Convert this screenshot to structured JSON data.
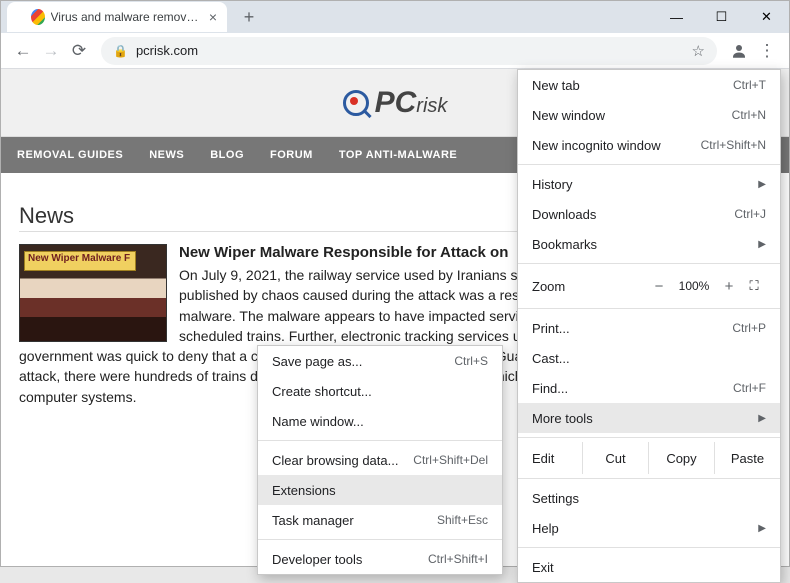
{
  "tab": {
    "title": "Virus and malware removal instru"
  },
  "url": "pcrisk.com",
  "logo": {
    "main": "PC",
    "sub": "risk"
  },
  "nav": [
    "REMOVAL GUIDES",
    "NEWS",
    "BLOG",
    "FORUM",
    "TOP ANTI-MALWARE"
  ],
  "section_title": "News",
  "article": {
    "thumb_label": "New Wiper Malware F",
    "headline": "New Wiper Malware Responsible for Attack on",
    "body": "On July 9, 2021, the railway service used by Iranians suffered a cyber attack. New research published by chaos caused during the attack was a result of a previously unknown wiper malware. The malware appears to have impacted services, as reports emerged of delays of scheduled trains. Further, electronic tracking services used by the train service also failed. The government was quick to deny that a cyber attack had occurred, saying. The Guardian reported that even a day after the attack, there were hundreds of trains delayed or cancelled the initial attack, which caused widespread disruption in … computer systems."
  },
  "menu": {
    "new_tab": "New tab",
    "new_tab_sc": "Ctrl+T",
    "new_window": "New window",
    "new_window_sc": "Ctrl+N",
    "incognito": "New incognito window",
    "incognito_sc": "Ctrl+Shift+N",
    "history": "History",
    "downloads": "Downloads",
    "downloads_sc": "Ctrl+J",
    "bookmarks": "Bookmarks",
    "zoom": "Zoom",
    "zoom_val": "100%",
    "print": "Print...",
    "print_sc": "Ctrl+P",
    "cast": "Cast...",
    "find": "Find...",
    "find_sc": "Ctrl+F",
    "more_tools": "More tools",
    "edit": "Edit",
    "cut": "Cut",
    "copy": "Copy",
    "paste": "Paste",
    "settings": "Settings",
    "help": "Help",
    "exit": "Exit"
  },
  "submenu": {
    "save_page": "Save page as...",
    "save_page_sc": "Ctrl+S",
    "shortcut": "Create shortcut...",
    "name_window": "Name window...",
    "clear_data": "Clear browsing data...",
    "clear_data_sc": "Ctrl+Shift+Del",
    "extensions": "Extensions",
    "task_mgr": "Task manager",
    "task_mgr_sc": "Shift+Esc",
    "dev_tools": "Developer tools",
    "dev_tools_sc": "Ctrl+Shift+I"
  }
}
